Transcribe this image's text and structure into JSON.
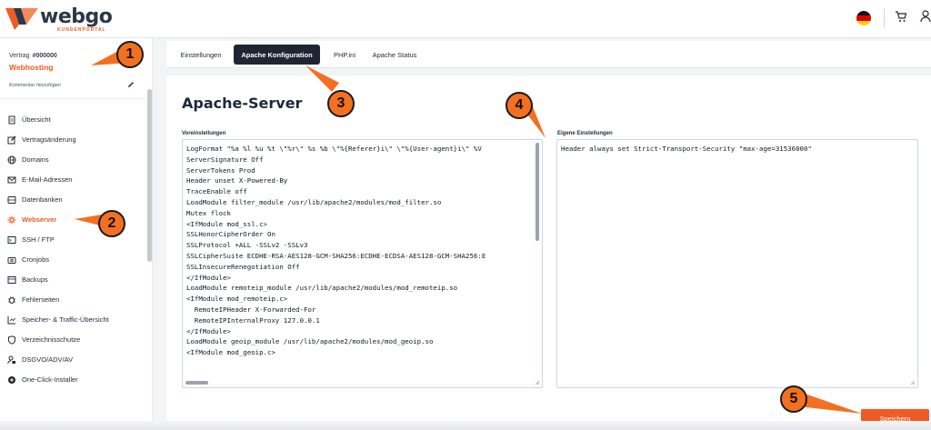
{
  "brand": {
    "name": "webgo",
    "subtitle": "KUNDENPORTAL",
    "accent": "#f15a24",
    "dark": "#1f2533"
  },
  "header": {
    "language_flag": "flag-de-icon",
    "cart": "cart-icon",
    "account": "user-icon"
  },
  "contract": {
    "label": "Vertrag",
    "number": "#000000",
    "type": "Webhosting",
    "comment_placeholder": "Kommentar hinzufügen"
  },
  "sidebar": {
    "items": [
      {
        "label": "Übersicht",
        "icon": "document-icon",
        "active": false
      },
      {
        "label": "Vertragsänderung",
        "icon": "edit-icon",
        "active": false
      },
      {
        "label": "Domains",
        "icon": "globe-icon",
        "active": false
      },
      {
        "label": "E-Mail-Adressen",
        "icon": "envelope-icon",
        "active": false
      },
      {
        "label": "Datenbanken",
        "icon": "database-icon",
        "active": false
      },
      {
        "label": "Webserver",
        "icon": "webserver-icon",
        "active": true
      },
      {
        "label": "SSH / FTP",
        "icon": "terminal-icon",
        "active": false
      },
      {
        "label": "Cronjobs",
        "icon": "cronjob-icon",
        "active": false
      },
      {
        "label": "Backups",
        "icon": "backup-icon",
        "active": false
      },
      {
        "label": "Fehlerseiten",
        "icon": "bug-icon",
        "active": false
      },
      {
        "label": "Speicher- & Traffic-Übersicht",
        "icon": "chart-icon",
        "active": false
      },
      {
        "label": "Verzeichnisschutze",
        "icon": "shield-icon",
        "active": false
      },
      {
        "label": "DSGVO/ADV/AV",
        "icon": "user-lock-icon",
        "active": false
      },
      {
        "label": "One-Click-Installer",
        "icon": "plus-circle-icon",
        "active": false
      }
    ]
  },
  "tabs": [
    {
      "label": "Einstellungen",
      "active": false
    },
    {
      "label": "Apache Konfiguration",
      "active": true
    },
    {
      "label": "PHP.ini",
      "active": false
    },
    {
      "label": "Apache Status",
      "active": false
    }
  ],
  "main": {
    "title": "Apache-Server",
    "defaults_label": "Voreinstellungen",
    "custom_label": "Eigene Einstellungen",
    "defaults_lines": [
      "LogFormat \"%a %l %u %t \\\"%r\\\" %s %b \\\"%{Referer}i\\\" \\\"%{User-agent}i\\\" %V",
      "ServerSignature Off",
      "ServerTokens Prod",
      "Header unset X-Powered-By",
      "TraceEnable off",
      "LoadModule filter_module /usr/lib/apache2/modules/mod_filter.so",
      "Mutex flock",
      "<IfModule mod_ssl.c>",
      "SSLHonorCipherOrder On",
      "SSLProtocol +ALL -SSLv2 -SSLv3",
      "SSLCipherSuite ECDHE-RSA-AES128-GCM-SHA256:ECDHE-ECDSA-AES128-GCM-SHA256:E",
      "SSLInsecureRenegotiation Off",
      "</IfModule>",
      "LoadModule remoteip_module /usr/lib/apache2/modules/mod_remoteip.so",
      "<IfModule mod_remoteip.c>",
      "  RemoteIPHeader X-Forwarded-For",
      "  RemoteIPInternalProxy 127.0.0.1",
      "</IfModule>",
      "LoadModule geoip_module /usr/lib/apache2/modules/mod_geoip.so",
      "<IfModule mod_geoip.c>"
    ],
    "custom_value": "Header always set Strict-Transport-Security \"max-age=31536000\"",
    "save_label": "Speichern"
  },
  "markers": [
    "1",
    "2",
    "3",
    "4",
    "5"
  ]
}
